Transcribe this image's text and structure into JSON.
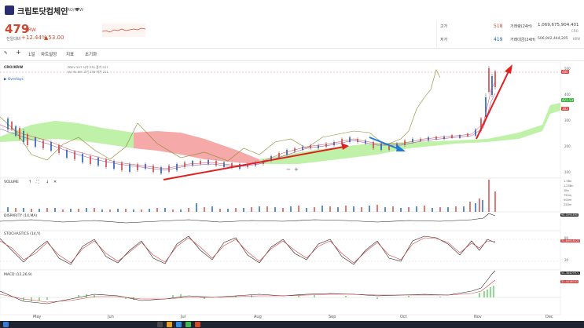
{
  "header": {
    "coin_name": "크립토닷컴체인",
    "pair": "CRO/KRW",
    "price": "479",
    "price_unit": "KRW",
    "change_label": "전일대비",
    "change_pct": "+12.44%",
    "change_abs": "▲53.00"
  },
  "stats": {
    "high_label": "고가",
    "high_value": "518",
    "low_label": "저가",
    "low_value": "419",
    "volume_label": "거래량(24H)",
    "volume_value": "1,069,675,904.401",
    "volume_unit": "CRO",
    "amount_label": "거래대금(24H)",
    "amount_value": "506,942,444,205",
    "amount_unit": "KRW"
  },
  "toolbar": {
    "period": "1일",
    "indicator_settings": "차트설정",
    "indicators": "지표",
    "reset": "초기화"
  },
  "panes": {
    "main_label": "CRO/KRW",
    "ohlc_line1": "PREV 227  시가 232  종가 227",
    "ohlc_line2": "Vol 94.8M  고가 238  저가 221",
    "overlays": "▶ Overlays",
    "volume_label": "VOLUME",
    "disparity_label": "DISPARITY (14,MA)",
    "stochastic_label": "STOCHASTICS (14,Y)",
    "macd_label": "MACD (12,26,9)"
  },
  "price_axis": [
    "500",
    "400",
    "300",
    "200",
    "100"
  ],
  "volume_axis": [
    "1.5Bn",
    "1.25Bn",
    "1Bn",
    "750m",
    "500m",
    "250m"
  ],
  "tags": {
    "price_last": "480",
    "price_mid": "421.53",
    "price_red": "383",
    "disparity": "98.0094890",
    "stochastic": "72.84918123",
    "macd_top": "54.38409971",
    "macd_bottom": "32.4418031"
  },
  "stoch_levels": [
    "80",
    "20"
  ],
  "months": [
    "May",
    "Jun",
    "Jul",
    "Aug",
    "Sep",
    "Oct",
    "Nov",
    "Dec"
  ],
  "zoom": {
    "minus": "−",
    "plus": "+"
  }
}
